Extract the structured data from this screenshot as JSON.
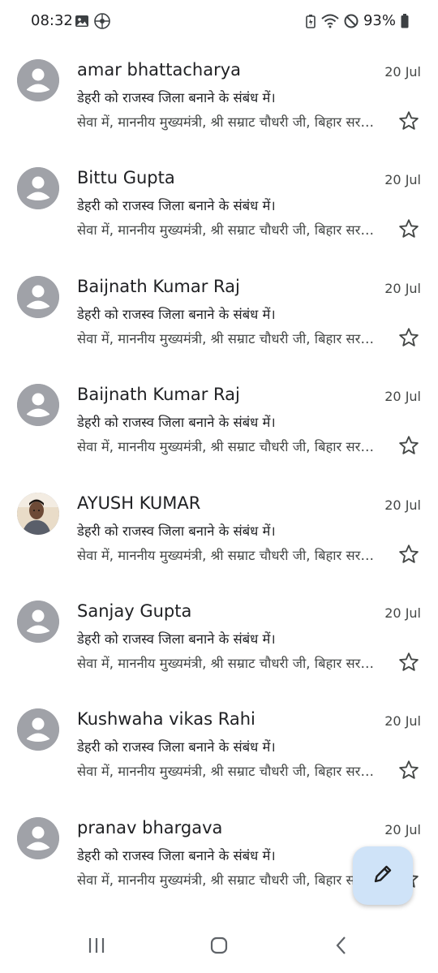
{
  "status_bar": {
    "time": "08:32",
    "battery": "93%",
    "left_icons": [
      "image-icon",
      "app-icon"
    ],
    "right_icons": [
      "battery-saver-icon",
      "wifi-icon",
      "do-not-disturb-icon",
      "battery-icon"
    ]
  },
  "emails": [
    {
      "sender": "amar bhattacharya",
      "date": "20 Jul",
      "subject": "डेहरी को राजस्व जिला बनाने के संबंध में।",
      "snippet": "सेवा में, माननीय मुख्यमंत्री, श्री सम्राट चौधरी जी, बिहार सरकार",
      "avatar": "default"
    },
    {
      "sender": "Bittu Gupta",
      "date": "20 Jul",
      "subject": "डेहरी को राजस्व जिला बनाने के संबंध में।",
      "snippet": "सेवा में, माननीय मुख्यमंत्री, श्री सम्राट चौधरी जी, बिहार सरकार",
      "avatar": "default"
    },
    {
      "sender": "Baijnath Kumar Raj",
      "date": "20 Jul",
      "subject": "डेहरी को राजस्व जिला बनाने के संबंध में।",
      "snippet": "सेवा में, माननीय मुख्यमंत्री, श्री सम्राट चौधरी जी, बिहार सरकार",
      "avatar": "default"
    },
    {
      "sender": "Baijnath Kumar Raj",
      "date": "20 Jul",
      "subject": "डेहरी को राजस्व जिला बनाने के संबंध में।",
      "snippet": "सेवा में, माननीय मुख्यमंत्री, श्री सम्राट चौधरी जी, बिहार सरकार",
      "avatar": "default"
    },
    {
      "sender": "AYUSH KUMAR",
      "date": "20 Jul",
      "subject": "डेहरी को राजस्व जिला बनाने के संबंध में।",
      "snippet": "सेवा में, माननीय मुख्यमंत्री, श्री सम्राट चौधरी जी, बिहार सरकार",
      "avatar": "photo"
    },
    {
      "sender": "Sanjay Gupta",
      "date": "20 Jul",
      "subject": "डेहरी को राजस्व जिला बनाने के संबंध में।",
      "snippet": "सेवा में, माननीय मुख्यमंत्री, श्री सम्राट चौधरी जी, बिहार सरकार",
      "avatar": "default"
    },
    {
      "sender": "Kushwaha vikas Rahi",
      "date": "20 Jul",
      "subject": "डेहरी को राजस्व जिला बनाने के संबंध में।",
      "snippet": "सेवा में, माननीय मुख्यमंत्री, श्री सम्राट चौधरी जी, बिहार सरकार",
      "avatar": "default"
    },
    {
      "sender": "pranav bhargava",
      "date": "20 Jul",
      "subject": "डेहरी को राजस्व जिला बनाने के संबंध में।",
      "snippet": "सेवा में, माननीय मुख्यमंत्री, श्री सम्राट चौधरी जी, बिहार सरकार",
      "avatar": "default"
    }
  ],
  "fab": {
    "icon": "pencil-icon"
  },
  "nav_bar": {
    "icons": [
      "recents-icon",
      "home-icon",
      "back-icon"
    ]
  },
  "colors": {
    "fab_bg": "#cfe3f8",
    "avatar_gray": "#a0a2a8",
    "text_primary": "#202124",
    "text_secondary": "#444746"
  }
}
